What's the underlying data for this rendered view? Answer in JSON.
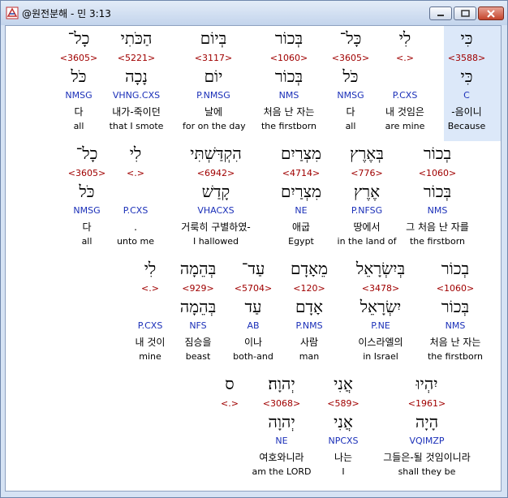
{
  "window": {
    "title": "@원전분해 - 민 3:13",
    "accent": "#c3d4ec"
  },
  "rows": [
    {
      "words": [
        {
          "heb": "כִּי",
          "num": "<3588>",
          "lemma": "כִּי",
          "morph": "C",
          "kor": "-음이니",
          "eng": "Because"
        },
        {
          "heb": "לִי",
          "num": "<.>",
          "lemma": "",
          "morph": "P.CXS",
          "kor": "내 것임은",
          "eng": "are mine"
        },
        {
          "heb": "כָּל־",
          "num": "<3605>",
          "lemma": "כֹּל",
          "morph": "NMSG",
          "kor": "다",
          "eng": "all"
        },
        {
          "heb": "בְּכוֹר",
          "num": "<1060>",
          "lemma": "בְּכוֹר",
          "morph": "NMS",
          "kor": "처음 난 자는",
          "eng": "the firstborn"
        },
        {
          "heb": "בְּיוֹם",
          "num": "<3117>",
          "lemma": "יוֹם",
          "morph": "P.NMSG",
          "kor": "날에",
          "eng": "for on the day"
        },
        {
          "heb": "הַכֹּתִי",
          "num": "<5221>",
          "lemma": "נָכָה",
          "morph": "VHNG.CXS",
          "kor": "내가-죽이던",
          "eng": "that I smote"
        },
        {
          "heb": "כָל־",
          "num": "<3605>",
          "lemma": "כֹּל",
          "morph": "NMSG",
          "kor": "다",
          "eng": "all"
        }
      ]
    },
    {
      "words": [
        {
          "heb": "בְכוֹר",
          "num": "<1060>",
          "lemma": "בְּכוֹר",
          "morph": "NMS",
          "kor": "그 처음 난 자를",
          "eng": "the firstborn"
        },
        {
          "heb": "בְּאֶרֶץ",
          "num": "<776>",
          "lemma": "אֶרֶץ",
          "morph": "P.NFSG",
          "kor": "땅에서",
          "eng": "in the land of"
        },
        {
          "heb": "מִצְרַיִם",
          "num": "<4714>",
          "lemma": "מִצְרַיִם",
          "morph": "NE",
          "kor": "애굽",
          "eng": "Egypt"
        },
        {
          "heb": "הִקְדַּשְׁתִּי",
          "num": "<6942>",
          "lemma": "קָדַשׁ",
          "morph": "VHACXS",
          "kor": "거룩히 구별하였-",
          "eng": "I hallowed"
        },
        {
          "heb": "לִי",
          "num": "<.>",
          "lemma": "",
          "morph": "P.CXS",
          "kor": ".",
          "eng": "unto me"
        },
        {
          "heb": "כָל־",
          "num": "<3605>",
          "lemma": "כֹּל",
          "morph": "NMSG",
          "kor": "다",
          "eng": "all"
        }
      ]
    },
    {
      "words": [
        {
          "heb": "בְכוֹר",
          "num": "<1060>",
          "lemma": "בְּכוֹר",
          "morph": "NMS",
          "kor": "처음 난 자는",
          "eng": "the firstborn"
        },
        {
          "heb": "בְּיִשְׂרָאֵל",
          "num": "<3478>",
          "lemma": "יִשְׂרָאֵל",
          "morph": "P.NE",
          "kor": "이스라엘의",
          "eng": "in Israel"
        },
        {
          "heb": "מֵאָדָם",
          "num": "<120>",
          "lemma": "אָדָם",
          "morph": "P.NMS",
          "kor": "사람",
          "eng": "man"
        },
        {
          "heb": "עַד־",
          "num": "<5704>",
          "lemma": "עַד",
          "morph": "AB",
          "kor": "이나",
          "eng": "both-and"
        },
        {
          "heb": "בְּהֵמָה",
          "num": "<929>",
          "lemma": "בְּהֵמָה",
          "morph": "NFS",
          "kor": "짐승을",
          "eng": "beast"
        },
        {
          "heb": "לִי",
          "num": "<.>",
          "lemma": "",
          "morph": "P.CXS",
          "kor": "내 것이",
          "eng": "mine"
        }
      ]
    },
    {
      "words": [
        {
          "heb": "יִהְיוּ",
          "num": "<1961>",
          "lemma": "הָיָה",
          "morph": "VQIMZP",
          "kor": "그들은-될 것임이니라",
          "eng": "shall they be"
        },
        {
          "heb": "אֲנִי",
          "num": "<589>",
          "lemma": "אֲנִי",
          "morph": "NPCXS",
          "kor": "나는",
          "eng": "I"
        },
        {
          "heb": "יְהוָה׃",
          "num": "<3068>",
          "lemma": "יְהוָה",
          "morph": "NE",
          "kor": "여호와니라",
          "eng": "am the LORD"
        },
        {
          "heb": "ס",
          "num": "<.>",
          "lemma": "",
          "morph": "",
          "kor": "",
          "eng": ""
        }
      ]
    }
  ]
}
